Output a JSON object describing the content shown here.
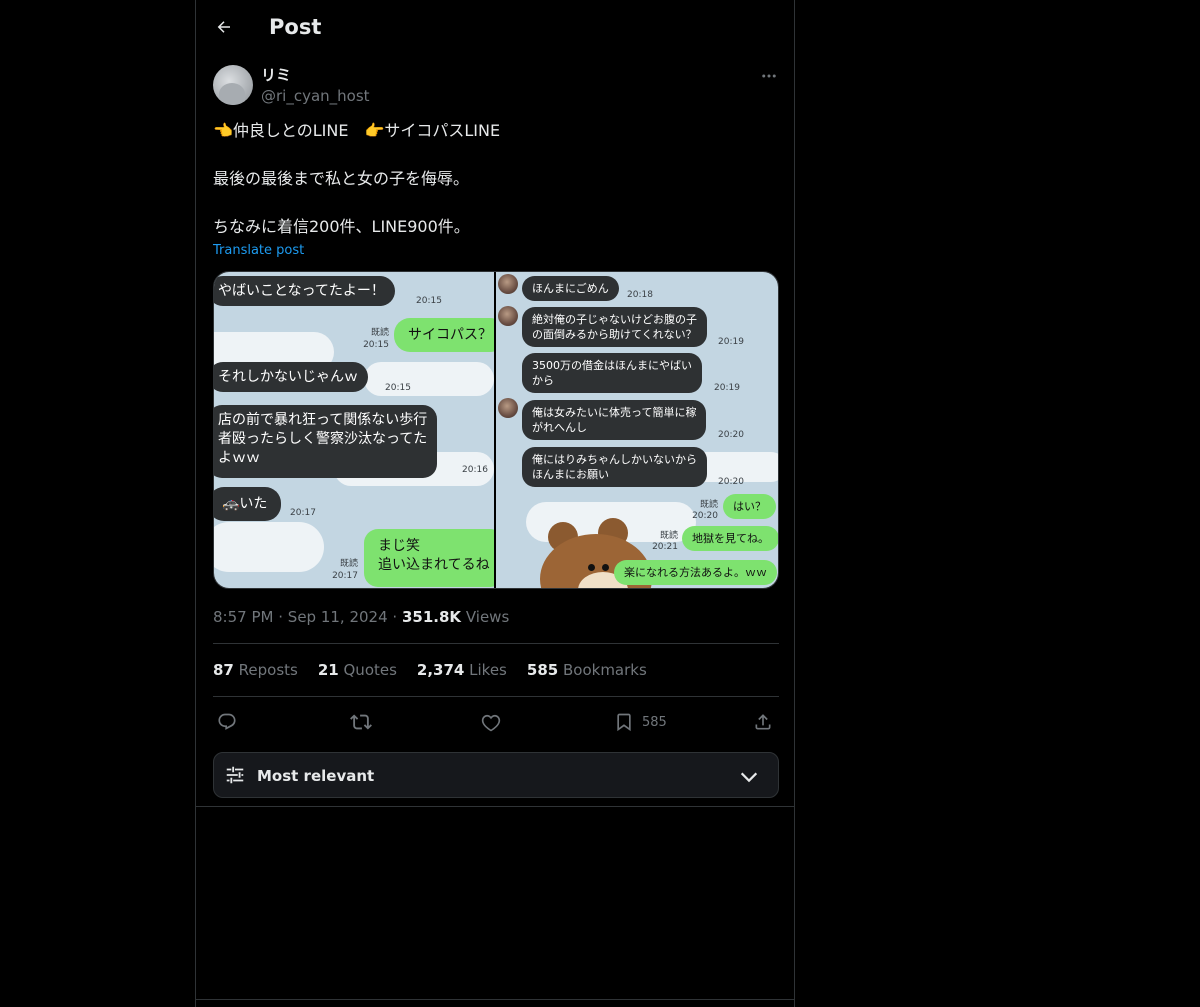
{
  "header": {
    "title": "Post",
    "back_icon": "arrow-left-icon"
  },
  "author": {
    "display_name": "リミ",
    "handle": "@ri_cyan_host"
  },
  "post": {
    "lines": [
      "👈仲良しとのLINE　👉サイコパスLINE",
      "最後の最後まで私と女の子を侮辱。",
      "ちなみに着信200件、LINE900件。"
    ],
    "translate_label": "Translate post"
  },
  "media": {
    "left_chat": [
      {
        "dir": "in",
        "text": "やばいことなってたよー！",
        "time": "20:15"
      },
      {
        "dir": "out",
        "text": "サイコパス？",
        "read": "既読",
        "time": "20:15"
      },
      {
        "dir": "in",
        "text": "それしかないじゃんｗ",
        "time": "20:15"
      },
      {
        "dir": "in",
        "text": "店の前で暴れ狂って関係ない歩行",
        "text2": "者殴ったらしく警察沙汰なってた",
        "text3": "よｗｗ",
        "time": "20:16"
      },
      {
        "dir": "in",
        "text": "🚓いた",
        "time": "20:17"
      },
      {
        "dir": "out",
        "text": "まじ笑",
        "text2": "追い込まれてるね",
        "read": "既読",
        "time": "20:17"
      }
    ],
    "right_chat": [
      {
        "dir": "in",
        "text": "ほんまにごめん",
        "time": "20:18"
      },
      {
        "dir": "in",
        "text": "絶対俺の子じゃないけどお腹の子",
        "text2": "の面倒みるから助けてくれない？",
        "time": "20:19"
      },
      {
        "dir": "in",
        "text": "3500万の借金はほんまにやばい",
        "text2": "から",
        "time": "20:19"
      },
      {
        "dir": "in",
        "text": "俺は女みたいに体売って簡単に稼",
        "text2": "がれへんし",
        "time": "20:20"
      },
      {
        "dir": "in",
        "text": "俺にはりみちゃんしかいないから",
        "text2": "ほんまにお願い",
        "time": "20:20"
      },
      {
        "dir": "out",
        "text": "はい？",
        "read": "既読",
        "time": "20:20"
      },
      {
        "dir": "out",
        "text": "地獄を見てね。",
        "read": "既読",
        "time": "20:21"
      },
      {
        "dir": "out",
        "text": "楽になれる方法あるよ。ｗｗ"
      }
    ]
  },
  "meta": {
    "time": "8:57 PM",
    "sep1": "·",
    "date": "Sep 11, 2024",
    "sep2": "·",
    "views_count": "351.8K",
    "views_label": "Views"
  },
  "stats": {
    "reposts_count": "87",
    "reposts_label": "Reposts",
    "quotes_count": "21",
    "quotes_label": "Quotes",
    "likes_count": "2,374",
    "likes_label": "Likes",
    "bookmarks_count": "585",
    "bookmarks_label": "Bookmarks"
  },
  "actions": {
    "reply_icon": "reply-icon",
    "repost_icon": "repost-icon",
    "like_icon": "heart-icon",
    "bookmark_icon": "bookmark-icon",
    "bookmark_count": "585",
    "share_icon": "share-icon"
  },
  "sort": {
    "label": "Most relevant",
    "icon": "sliders-icon",
    "chevron": "chevron-down-icon"
  },
  "colors": {
    "background": "#000000",
    "text": "#e7e9ea",
    "muted": "#71767b",
    "link": "#1d9bf0",
    "border": "#2f3336",
    "line_green": "#7ee26f"
  }
}
